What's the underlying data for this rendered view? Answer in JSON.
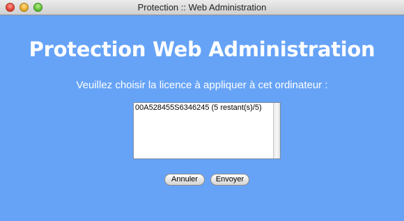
{
  "window": {
    "title": "Protection :: Web Administration"
  },
  "page": {
    "heading": "Protection Web Administration",
    "prompt": "Veuillez choisir la licence à appliquer à cet ordinateur :"
  },
  "license_list": {
    "options": [
      "00A528455S6346245 (5 restant(s)/5)"
    ]
  },
  "buttons": {
    "cancel_label": "Annuler",
    "submit_label": "Envoyer"
  },
  "colors": {
    "background": "#66a3f7",
    "heading_text": "#ffffff"
  }
}
